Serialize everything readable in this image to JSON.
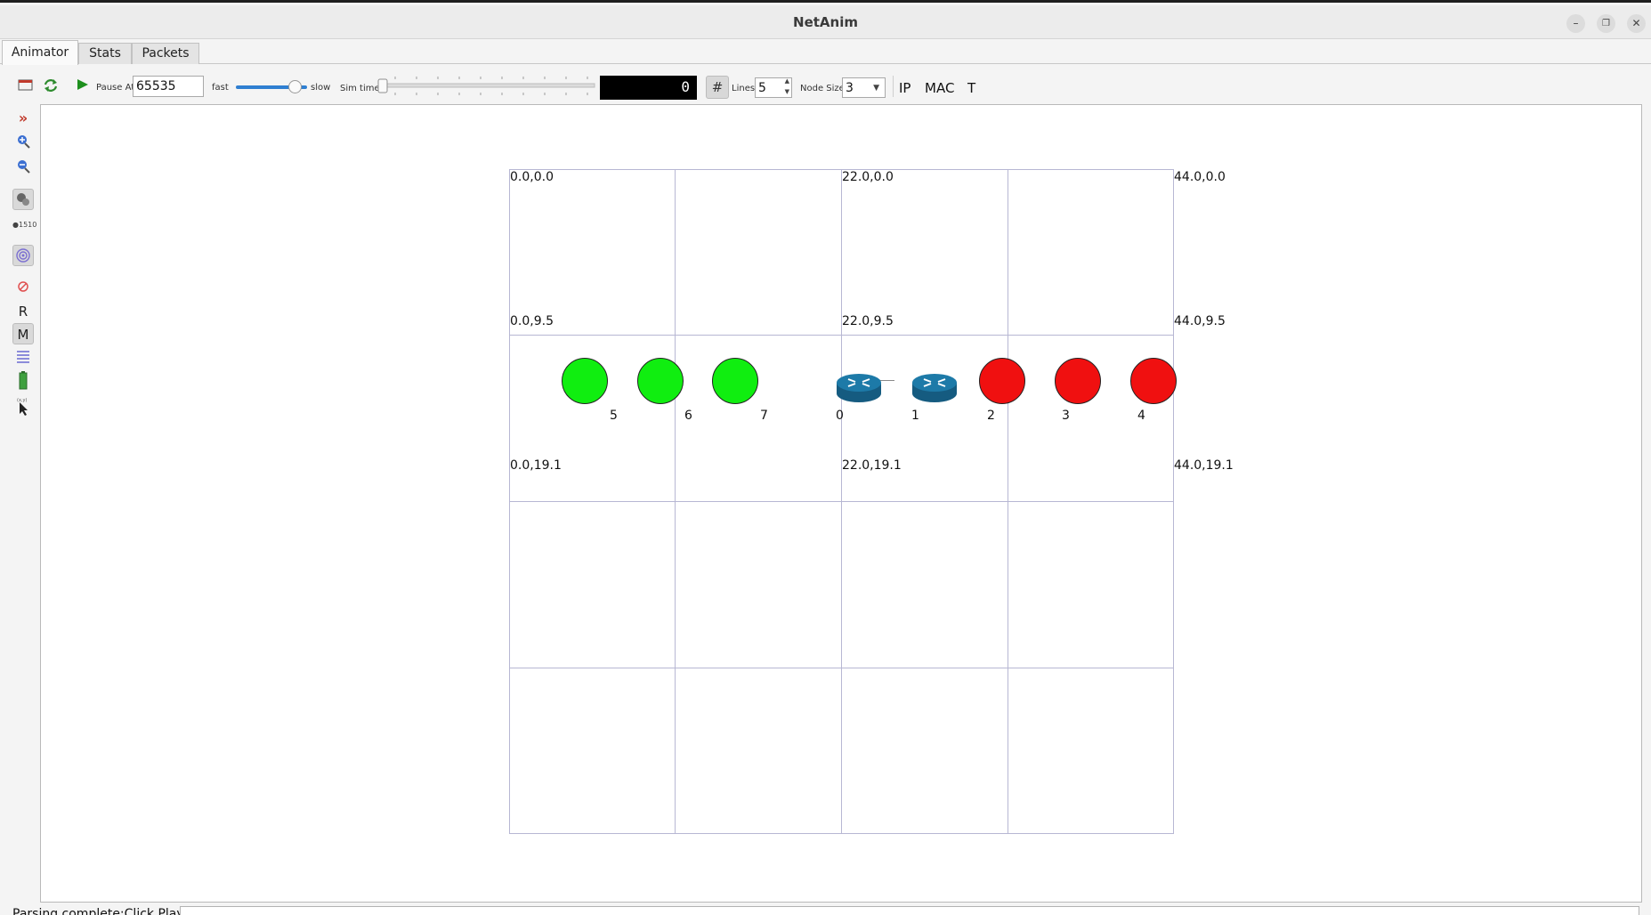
{
  "window": {
    "title": "NetAnim"
  },
  "tabs": [
    "Animator",
    "Stats",
    "Packets"
  ],
  "toolbar": {
    "pause_at_label": "Pause At",
    "pause_at_value": "65535",
    "speed_fast_label": "fast",
    "speed_slow_label": "slow",
    "sim_time_label": "Sim time",
    "sim_time_display": "0",
    "lines_label": "Lines",
    "lines_value": "5",
    "node_size_label": "Node Size",
    "node_size_value": "3",
    "ip_label": "IP",
    "mac_label": "MAC",
    "t_label": "T"
  },
  "left_toolbar": {
    "r_label": "R",
    "m_label": "M"
  },
  "grid": {
    "coords": {
      "tl": "0.0,0.0",
      "tm": "22.0,0.0",
      "tr": "44.0,0.0",
      "ml": "0.0,9.5",
      "mm": "22.0,9.5",
      "mr": "44.0,9.5",
      "bl": "0.0,19.1",
      "bm": "22.0,19.1",
      "br": "44.0,19.1"
    }
  },
  "nodes": [
    {
      "id": "5",
      "kind": "circle",
      "color": "#10ee10"
    },
    {
      "id": "6",
      "kind": "circle",
      "color": "#10ee10"
    },
    {
      "id": "7",
      "kind": "circle",
      "color": "#10ee10"
    },
    {
      "id": "0",
      "kind": "router",
      "color": "#1a6f9a"
    },
    {
      "id": "1",
      "kind": "router",
      "color": "#1a6f9a"
    },
    {
      "id": "2",
      "kind": "circle",
      "color": "#f01010"
    },
    {
      "id": "3",
      "kind": "circle",
      "color": "#f01010"
    },
    {
      "id": "4",
      "kind": "circle",
      "color": "#f01010"
    }
  ],
  "status": {
    "message": "Parsing complete:Click Play"
  }
}
